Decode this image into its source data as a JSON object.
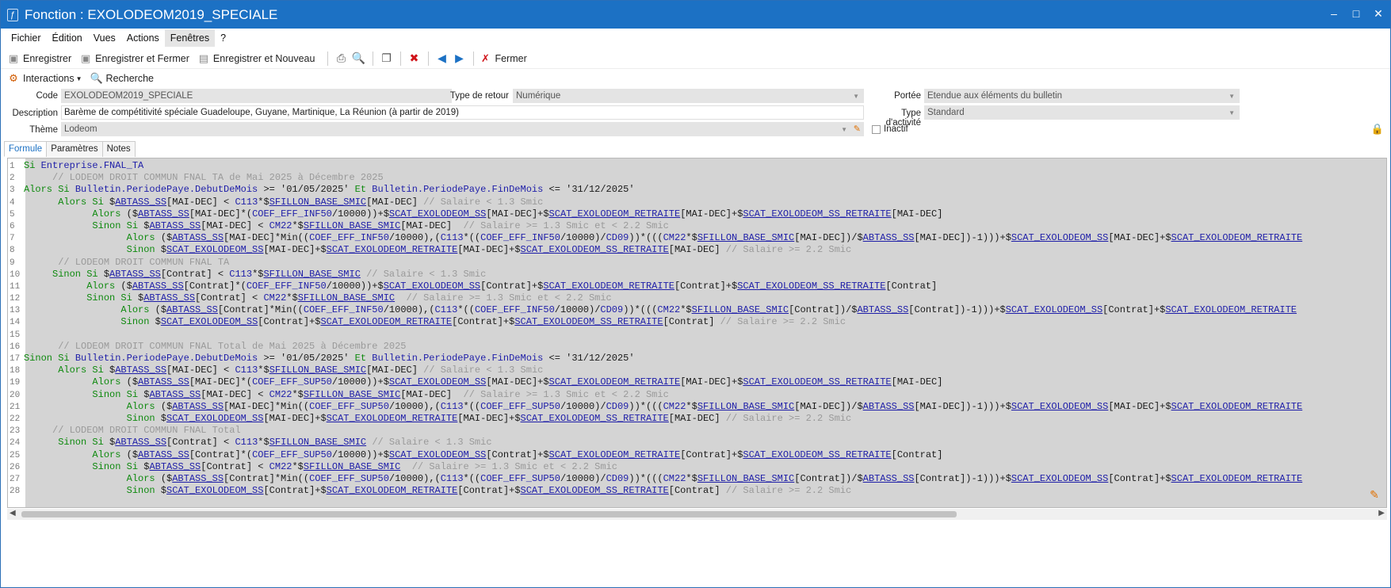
{
  "window": {
    "title": "Fonction : EXOLODEOM2019_SPECIALE",
    "app_icon": "fx-icon",
    "controls": [
      "–",
      "□",
      "✕"
    ]
  },
  "menu": [
    "Fichier",
    "Édition",
    "Vues",
    "Actions",
    "Fenêtres",
    "?"
  ],
  "menu_active": "Fenêtres",
  "toolbar": {
    "save": "Enregistrer",
    "save_close": "Enregistrer et Fermer",
    "save_new": "Enregistrer et Nouveau",
    "close": "Fermer"
  },
  "toolbar2": {
    "interactions": "Interactions",
    "search": "Recherche"
  },
  "form": {
    "code_label": "Code",
    "code_value": "EXOLODEOM2019_SPECIALE",
    "return_type_label": "Type de retour",
    "return_type_value": "Numérique",
    "scope_label": "Portée",
    "scope_value": "Etendue aux éléments du bulletin",
    "description_label": "Description",
    "description_value": "Barème de compétitivité spéciale Guadeloupe, Guyane, Martinique, La Réunion (à partir de 2019)",
    "activity_label": "Type d'activité",
    "activity_value": "Standard",
    "theme_label": "Thème",
    "theme_value": "Lodeom",
    "inactive_label": "Inactif"
  },
  "tabs": [
    "Formule",
    "Paramètres",
    "Notes"
  ],
  "tab_active": "Formule",
  "colors": {
    "titlebar": "#1c71c4",
    "keyword": "#0f8a0f",
    "comment": "#9a9a9a",
    "variable": "#1e1ea8",
    "editor_bg": "#d4d4d4"
  },
  "code_lines": [
    [
      [
        "kw",
        "Si "
      ],
      [
        "kb",
        "Entreprise.FNAL_TA"
      ]
    ],
    [
      [
        "cm",
        "     // LODEOM DROIT COMMUN FNAL TA de Mai 2025 à Décembre 2025"
      ]
    ],
    [
      [
        "kw",
        "Alors Si "
      ],
      [
        "kb",
        "Bulletin.PeriodePaye.DebutDeMois"
      ],
      [
        "tx",
        " >= '01/05/2025' "
      ],
      [
        "kw",
        "Et "
      ],
      [
        "kb",
        "Bulletin.PeriodePaye.FinDeMois"
      ],
      [
        "tx",
        " <= '31/12/2025'"
      ]
    ],
    [
      [
        "kw",
        "      Alors Si "
      ],
      [
        "tx",
        "$"
      ],
      [
        "vr",
        "ABTASS_SS"
      ],
      [
        "tx",
        "[MAI-DEC] < "
      ],
      [
        "fn",
        "C113"
      ],
      [
        "tx",
        "*$"
      ],
      [
        "vr",
        "SFILLON_BASE_SMIC"
      ],
      [
        "tx",
        "[MAI-DEC] "
      ],
      [
        "cm",
        "// Salaire < 1.3 Smic"
      ]
    ],
    [
      [
        "kw",
        "            Alors "
      ],
      [
        "tx",
        "($"
      ],
      [
        "vr",
        "ABTASS_SS"
      ],
      [
        "tx",
        "[MAI-DEC]*("
      ],
      [
        "fn",
        "COEF_EFF_INF50"
      ],
      [
        "tx",
        "/10000))+$"
      ],
      [
        "vr",
        "SCAT_EXOLODEOM_SS"
      ],
      [
        "tx",
        "[MAI-DEC]+$"
      ],
      [
        "vr",
        "SCAT_EXOLODEOM_RETRAITE"
      ],
      [
        "tx",
        "[MAI-DEC]+$"
      ],
      [
        "vr",
        "SCAT_EXOLODEOM_SS_RETRAITE"
      ],
      [
        "tx",
        "[MAI-DEC]"
      ]
    ],
    [
      [
        "kw",
        "            Sinon Si "
      ],
      [
        "tx",
        "$"
      ],
      [
        "vr",
        "ABTASS_SS"
      ],
      [
        "tx",
        "[MAI-DEC] < "
      ],
      [
        "fn",
        "CM22"
      ],
      [
        "tx",
        "*$"
      ],
      [
        "vr",
        "SFILLON_BASE_SMIC"
      ],
      [
        "tx",
        "[MAI-DEC]  "
      ],
      [
        "cm",
        "// Salaire >= 1.3 Smic et < 2.2 Smic"
      ]
    ],
    [
      [
        "kw",
        "                  Alors "
      ],
      [
        "tx",
        "($"
      ],
      [
        "vr",
        "ABTASS_SS"
      ],
      [
        "tx",
        "[MAI-DEC]*Min(("
      ],
      [
        "fn",
        "COEF_EFF_INF50"
      ],
      [
        "tx",
        "/10000),("
      ],
      [
        "fn",
        "C113"
      ],
      [
        "tx",
        "*(("
      ],
      [
        "fn",
        "COEF_EFF_INF50"
      ],
      [
        "tx",
        "/10000)/"
      ],
      [
        "fn",
        "CD09"
      ],
      [
        "tx",
        "))*((("
      ],
      [
        "fn",
        "CM22"
      ],
      [
        "tx",
        "*$"
      ],
      [
        "vr",
        "SFILLON_BASE_SMIC"
      ],
      [
        "tx",
        "[MAI-DEC])/$"
      ],
      [
        "vr",
        "ABTASS_SS"
      ],
      [
        "tx",
        "[MAI-DEC])-1)))+$"
      ],
      [
        "vr",
        "SCAT_EXOLODEOM_SS"
      ],
      [
        "tx",
        "[MAI-DEC]+$"
      ],
      [
        "vr",
        "SCAT_EXOLODEOM_RETRAITE"
      ]
    ],
    [
      [
        "kw",
        "                  Sinon "
      ],
      [
        "tx",
        "$"
      ],
      [
        "vr",
        "SCAT_EXOLODEOM_SS"
      ],
      [
        "tx",
        "[MAI-DEC]+$"
      ],
      [
        "vr",
        "SCAT_EXOLODEOM_RETRAITE"
      ],
      [
        "tx",
        "[MAI-DEC]+$"
      ],
      [
        "vr",
        "SCAT_EXOLODEOM_SS_RETRAITE"
      ],
      [
        "tx",
        "[MAI-DEC] "
      ],
      [
        "cm",
        "// Salaire >= 2.2 Smic"
      ]
    ],
    [
      [
        "cm",
        "      // LODEOM DROIT COMMUN FNAL TA"
      ]
    ],
    [
      [
        "kw",
        "     Sinon Si "
      ],
      [
        "tx",
        "$"
      ],
      [
        "vr",
        "ABTASS_SS"
      ],
      [
        "tx",
        "[Contrat] < "
      ],
      [
        "fn",
        "C113"
      ],
      [
        "tx",
        "*$"
      ],
      [
        "vr",
        "SFILLON_BASE_SMIC"
      ],
      [
        "tx",
        " "
      ],
      [
        "cm",
        "// Salaire < 1.3 Smic"
      ]
    ],
    [
      [
        "kw",
        "           Alors "
      ],
      [
        "tx",
        "($"
      ],
      [
        "vr",
        "ABTASS_SS"
      ],
      [
        "tx",
        "[Contrat]*("
      ],
      [
        "fn",
        "COEF_EFF_INF50"
      ],
      [
        "tx",
        "/10000))+$"
      ],
      [
        "vr",
        "SCAT_EXOLODEOM_SS"
      ],
      [
        "tx",
        "[Contrat]+$"
      ],
      [
        "vr",
        "SCAT_EXOLODEOM_RETRAITE"
      ],
      [
        "tx",
        "[Contrat]+$"
      ],
      [
        "vr",
        "SCAT_EXOLODEOM_SS_RETRAITE"
      ],
      [
        "tx",
        "[Contrat]"
      ]
    ],
    [
      [
        "kw",
        "           Sinon Si "
      ],
      [
        "tx",
        "$"
      ],
      [
        "vr",
        "ABTASS_SS"
      ],
      [
        "tx",
        "[Contrat] < "
      ],
      [
        "fn",
        "CM22"
      ],
      [
        "tx",
        "*$"
      ],
      [
        "vr",
        "SFILLON_BASE_SMIC"
      ],
      [
        "tx",
        "  "
      ],
      [
        "cm",
        "// Salaire >= 1.3 Smic et < 2.2 Smic"
      ]
    ],
    [
      [
        "kw",
        "                 Alors "
      ],
      [
        "tx",
        "($"
      ],
      [
        "vr",
        "ABTASS_SS"
      ],
      [
        "tx",
        "[Contrat]*Min(("
      ],
      [
        "fn",
        "COEF_EFF_INF50"
      ],
      [
        "tx",
        "/10000),("
      ],
      [
        "fn",
        "C113"
      ],
      [
        "tx",
        "*(("
      ],
      [
        "fn",
        "COEF_EFF_INF50"
      ],
      [
        "tx",
        "/10000)/"
      ],
      [
        "fn",
        "CD09"
      ],
      [
        "tx",
        "))*((("
      ],
      [
        "fn",
        "CM22"
      ],
      [
        "tx",
        "*$"
      ],
      [
        "vr",
        "SFILLON_BASE_SMIC"
      ],
      [
        "tx",
        "[Contrat])/$"
      ],
      [
        "vr",
        "ABTASS_SS"
      ],
      [
        "tx",
        "[Contrat])-1)))+$"
      ],
      [
        "vr",
        "SCAT_EXOLODEOM_SS"
      ],
      [
        "tx",
        "[Contrat]+$"
      ],
      [
        "vr",
        "SCAT_EXOLODEOM_RETRAITE"
      ]
    ],
    [
      [
        "kw",
        "                 Sinon "
      ],
      [
        "tx",
        "$"
      ],
      [
        "vr",
        "SCAT_EXOLODEOM_SS"
      ],
      [
        "tx",
        "[Contrat]+$"
      ],
      [
        "vr",
        "SCAT_EXOLODEOM_RETRAITE"
      ],
      [
        "tx",
        "[Contrat]+$"
      ],
      [
        "vr",
        "SCAT_EXOLODEOM_SS_RETRAITE"
      ],
      [
        "tx",
        "[Contrat] "
      ],
      [
        "cm",
        "// Salaire >= 2.2 Smic"
      ]
    ],
    [],
    [
      [
        "cm",
        "      // LODEOM DROIT COMMUN FNAL Total de Mai 2025 à Décembre 2025"
      ]
    ],
    [
      [
        "kw",
        "Sinon Si "
      ],
      [
        "kb",
        "Bulletin.PeriodePaye.DebutDeMois"
      ],
      [
        "tx",
        " >= '01/05/2025' "
      ],
      [
        "kw",
        "Et "
      ],
      [
        "kb",
        "Bulletin.PeriodePaye.FinDeMois"
      ],
      [
        "tx",
        " <= '31/12/2025'"
      ]
    ],
    [
      [
        "kw",
        "      Alors Si "
      ],
      [
        "tx",
        "$"
      ],
      [
        "vr",
        "ABTASS_SS"
      ],
      [
        "tx",
        "[MAI-DEC] < "
      ],
      [
        "fn",
        "C113"
      ],
      [
        "tx",
        "*$"
      ],
      [
        "vr",
        "SFILLON_BASE_SMIC"
      ],
      [
        "tx",
        "[MAI-DEC] "
      ],
      [
        "cm",
        "// Salaire < 1.3 Smic"
      ]
    ],
    [
      [
        "kw",
        "            Alors "
      ],
      [
        "tx",
        "($"
      ],
      [
        "vr",
        "ABTASS_SS"
      ],
      [
        "tx",
        "[MAI-DEC]*("
      ],
      [
        "fn",
        "COEF_EFF_SUP50"
      ],
      [
        "tx",
        "/10000))+$"
      ],
      [
        "vr",
        "SCAT_EXOLODEOM_SS"
      ],
      [
        "tx",
        "[MAI-DEC]+$"
      ],
      [
        "vr",
        "SCAT_EXOLODEOM_RETRAITE"
      ],
      [
        "tx",
        "[MAI-DEC]+$"
      ],
      [
        "vr",
        "SCAT_EXOLODEOM_SS_RETRAITE"
      ],
      [
        "tx",
        "[MAI-DEC]"
      ]
    ],
    [
      [
        "kw",
        "            Sinon Si "
      ],
      [
        "tx",
        "$"
      ],
      [
        "vr",
        "ABTASS_SS"
      ],
      [
        "tx",
        "[MAI-DEC] < "
      ],
      [
        "fn",
        "CM22"
      ],
      [
        "tx",
        "*$"
      ],
      [
        "vr",
        "SFILLON_BASE_SMIC"
      ],
      [
        "tx",
        "[MAI-DEC]  "
      ],
      [
        "cm",
        "// Salaire >= 1.3 Smic et < 2.2 Smic"
      ]
    ],
    [
      [
        "kw",
        "                  Alors "
      ],
      [
        "tx",
        "($"
      ],
      [
        "vr",
        "ABTASS_SS"
      ],
      [
        "tx",
        "[MAI-DEC]*Min(("
      ],
      [
        "fn",
        "COEF_EFF_SUP50"
      ],
      [
        "tx",
        "/10000),("
      ],
      [
        "fn",
        "C113"
      ],
      [
        "tx",
        "*(("
      ],
      [
        "fn",
        "COEF_EFF_SUP50"
      ],
      [
        "tx",
        "/10000)/"
      ],
      [
        "fn",
        "CD09"
      ],
      [
        "tx",
        "))*((("
      ],
      [
        "fn",
        "CM22"
      ],
      [
        "tx",
        "*$"
      ],
      [
        "vr",
        "SFILLON_BASE_SMIC"
      ],
      [
        "tx",
        "[MAI-DEC])/$"
      ],
      [
        "vr",
        "ABTASS_SS"
      ],
      [
        "tx",
        "[MAI-DEC])-1)))+$"
      ],
      [
        "vr",
        "SCAT_EXOLODEOM_SS"
      ],
      [
        "tx",
        "[MAI-DEC]+$"
      ],
      [
        "vr",
        "SCAT_EXOLODEOM_RETRAITE"
      ]
    ],
    [
      [
        "kw",
        "                  Sinon "
      ],
      [
        "tx",
        "$"
      ],
      [
        "vr",
        "SCAT_EXOLODEOM_SS"
      ],
      [
        "tx",
        "[MAI-DEC]+$"
      ],
      [
        "vr",
        "SCAT_EXOLODEOM_RETRAITE"
      ],
      [
        "tx",
        "[MAI-DEC]+$"
      ],
      [
        "vr",
        "SCAT_EXOLODEOM_SS_RETRAITE"
      ],
      [
        "tx",
        "[MAI-DEC] "
      ],
      [
        "cm",
        "// Salaire >= 2.2 Smic"
      ]
    ],
    [
      [
        "cm",
        "     // LODEOM DROIT COMMUN FNAL Total"
      ]
    ],
    [
      [
        "kw",
        "      Sinon Si "
      ],
      [
        "tx",
        "$"
      ],
      [
        "vr",
        "ABTASS_SS"
      ],
      [
        "tx",
        "[Contrat] < "
      ],
      [
        "fn",
        "C113"
      ],
      [
        "tx",
        "*$"
      ],
      [
        "vr",
        "SFILLON_BASE_SMIC"
      ],
      [
        "tx",
        " "
      ],
      [
        "cm",
        "// Salaire < 1.3 Smic"
      ]
    ],
    [
      [
        "kw",
        "            Alors "
      ],
      [
        "tx",
        "($"
      ],
      [
        "vr",
        "ABTASS_SS"
      ],
      [
        "tx",
        "[Contrat]*("
      ],
      [
        "fn",
        "COEF_EFF_SUP50"
      ],
      [
        "tx",
        "/10000))+$"
      ],
      [
        "vr",
        "SCAT_EXOLODEOM_SS"
      ],
      [
        "tx",
        "[Contrat]+$"
      ],
      [
        "vr",
        "SCAT_EXOLODEOM_RETRAITE"
      ],
      [
        "tx",
        "[Contrat]+$"
      ],
      [
        "vr",
        "SCAT_EXOLODEOM_SS_RETRAITE"
      ],
      [
        "tx",
        "[Contrat]"
      ]
    ],
    [
      [
        "kw",
        "            Sinon Si "
      ],
      [
        "tx",
        "$"
      ],
      [
        "vr",
        "ABTASS_SS"
      ],
      [
        "tx",
        "[Contrat] < "
      ],
      [
        "fn",
        "CM22"
      ],
      [
        "tx",
        "*$"
      ],
      [
        "vr",
        "SFILLON_BASE_SMIC"
      ],
      [
        "tx",
        "  "
      ],
      [
        "cm",
        "// Salaire >= 1.3 Smic et < 2.2 Smic"
      ]
    ],
    [
      [
        "kw",
        "                  Alors "
      ],
      [
        "tx",
        "($"
      ],
      [
        "vr",
        "ABTASS_SS"
      ],
      [
        "tx",
        "[Contrat]*Min(("
      ],
      [
        "fn",
        "COEF_EFF_SUP50"
      ],
      [
        "tx",
        "/10000),("
      ],
      [
        "fn",
        "C113"
      ],
      [
        "tx",
        "*(("
      ],
      [
        "fn",
        "COEF_EFF_SUP50"
      ],
      [
        "tx",
        "/10000)/"
      ],
      [
        "fn",
        "CD09"
      ],
      [
        "tx",
        "))*((("
      ],
      [
        "fn",
        "CM22"
      ],
      [
        "tx",
        "*$"
      ],
      [
        "vr",
        "SFILLON_BASE_SMIC"
      ],
      [
        "tx",
        "[Contrat])/$"
      ],
      [
        "vr",
        "ABTASS_SS"
      ],
      [
        "tx",
        "[Contrat])-1)))+$"
      ],
      [
        "vr",
        "SCAT_EXOLODEOM_SS"
      ],
      [
        "tx",
        "[Contrat]+$"
      ],
      [
        "vr",
        "SCAT_EXOLODEOM_RETRAITE"
      ]
    ],
    [
      [
        "kw",
        "                  Sinon "
      ],
      [
        "tx",
        "$"
      ],
      [
        "vr",
        "SCAT_EXOLODEOM_SS"
      ],
      [
        "tx",
        "[Contrat]+$"
      ],
      [
        "vr",
        "SCAT_EXOLODEOM_RETRAITE"
      ],
      [
        "tx",
        "[Contrat]+$"
      ],
      [
        "vr",
        "SCAT_EXOLODEOM_SS_RETRAITE"
      ],
      [
        "tx",
        "[Contrat] "
      ],
      [
        "cm",
        "// Salaire >= 2.2 Smic"
      ]
    ]
  ]
}
